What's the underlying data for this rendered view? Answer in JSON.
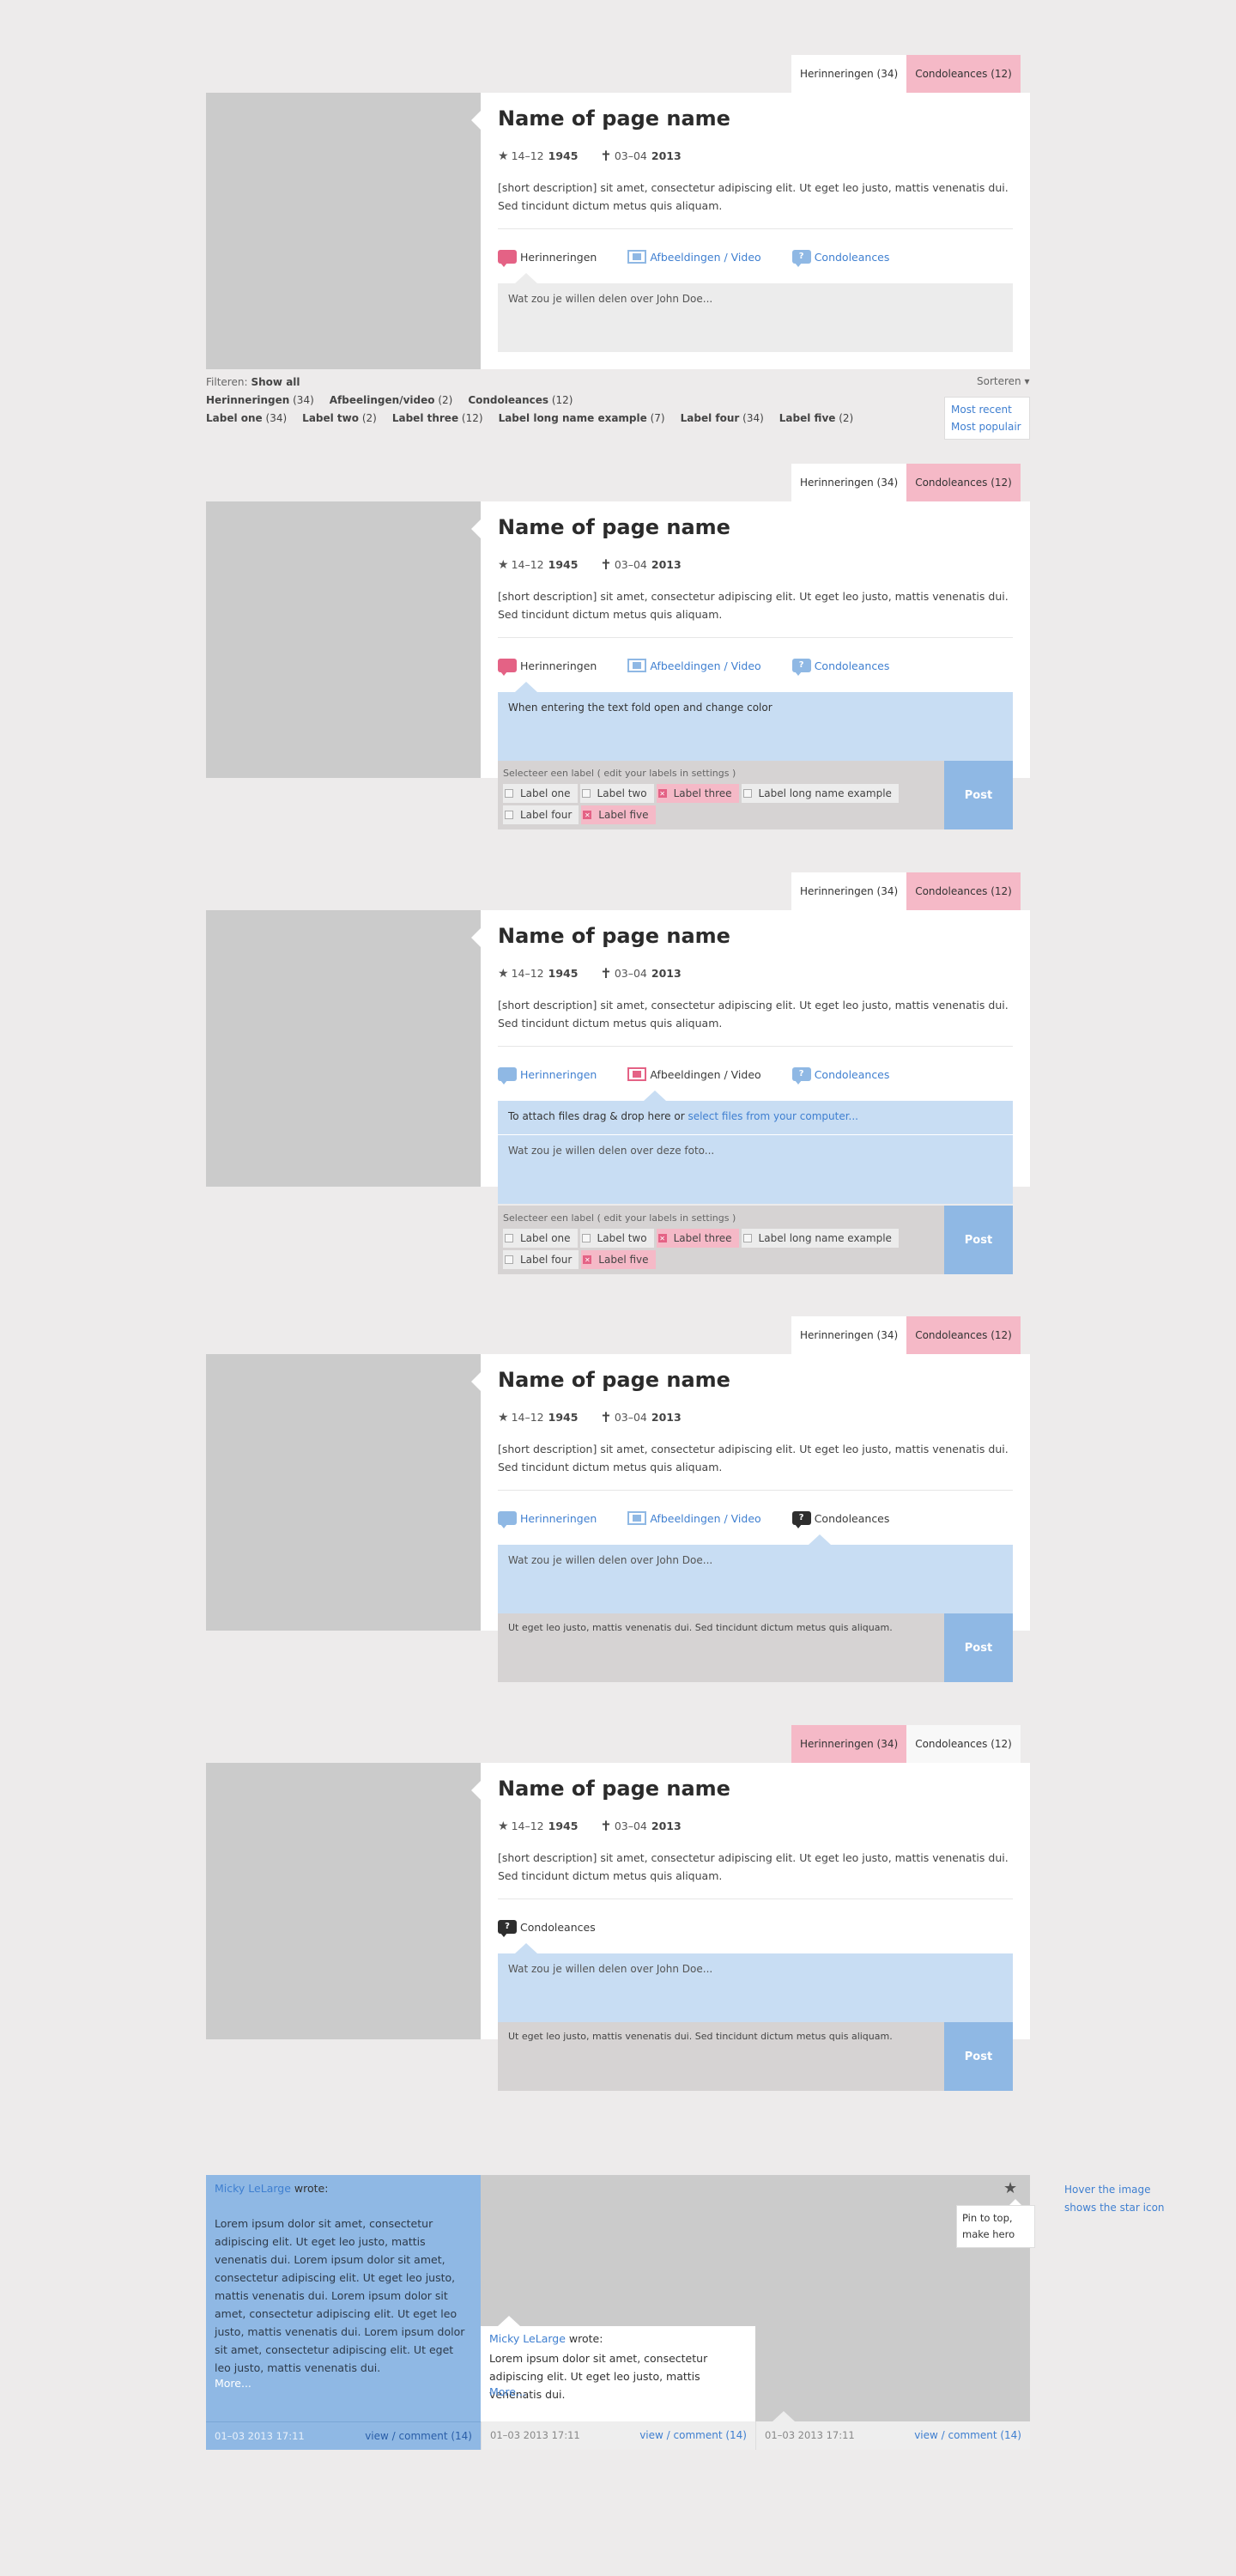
{
  "page": {
    "title": "Name of page name",
    "birth_day": "14–12",
    "birth_year": "1945",
    "death_day": "03–04",
    "death_year": "2013",
    "description": "[short description] sit amet, consectetur adipiscing elit. Ut eget leo justo, mattis venenatis dui. Sed tincidunt dictum metus quis aliquam."
  },
  "tabs": {
    "herinneringen": "Herinneringen (34)",
    "condoleances": "Condoleances (12)"
  },
  "actions": {
    "herinneringen": "Herinneringen",
    "afbeeldingen": "Afbeeldingen / Video",
    "condoleances": "Condoleances"
  },
  "compose": {
    "placeholder_john": "Wat zou je willen delen over John Doe...",
    "open_text": "When entering the text fold open and change color",
    "attach_text": "To attach files drag & drop here or ",
    "attach_link": "select files from your computer...",
    "photo_placeholder": "Wat zou je willen delen over deze foto...",
    "label_placeholder": "Selecteer een label ( edit your labels in settings )",
    "post": "Post",
    "condolence_text": "Ut eget leo justo, mattis venenatis dui. Sed tincidunt dictum metus quis aliquam."
  },
  "labels": [
    "Label one",
    "Label two",
    "Label three",
    "Label long name example",
    "Label four",
    "Label five"
  ],
  "filters": {
    "prefix": "Filteren:",
    "show_all": "Show all",
    "row1": [
      {
        "name": "Herinneringen",
        "count": "(34)"
      },
      {
        "name": "Afbeelingen/video",
        "count": "(2)"
      },
      {
        "name": "Condoleances",
        "count": "(12)"
      }
    ],
    "row2": [
      {
        "name": "Label one",
        "count": "(34)"
      },
      {
        "name": "Label two",
        "count": "(2)"
      },
      {
        "name": "Label three",
        "count": "(12)"
      },
      {
        "name": "Label long name example",
        "count": "(7)"
      },
      {
        "name": "Label four",
        "count": "(34)"
      },
      {
        "name": "Label five",
        "count": "(2)"
      }
    ],
    "sort_label": "Sorteren",
    "sort_options": [
      "Most recent",
      "Most populair"
    ]
  },
  "cards": {
    "author": "Micky LeLarge",
    "wrote": "wrote:",
    "long_text": "Lorem ipsum dolor sit amet, consectetur adipiscing elit. Ut eget leo justo, mattis venenatis dui.  Lorem ipsum dolor sit amet, consectetur adipiscing elit. Ut eget leo justo, mattis venenatis dui. Lorem ipsum dolor sit amet, consectetur adipiscing elit. Ut eget leo justo, mattis venenatis dui. Lorem ipsum dolor sit amet, consectetur adipiscing elit. Ut eget leo justo, mattis venenatis dui.",
    "more": "More...",
    "short_text": "Lorem ipsum dolor sit amet, consectetur adipiscing elit. Ut eget leo justo, mattis venenatis dui.",
    "date": "01–03 2013 17:11",
    "view": "view",
    "slash": "/",
    "comment": "comment (14)",
    "pin_text": "Pin to top, make hero",
    "hint": "Hover the image shows the star icon"
  },
  "colors": {
    "accent_pink": "#e46285",
    "tab_pink": "#f5b9c7",
    "accent_blue": "#8fb8e4",
    "light_blue": "#c8ddf3",
    "link_blue": "#3f7fd0"
  }
}
